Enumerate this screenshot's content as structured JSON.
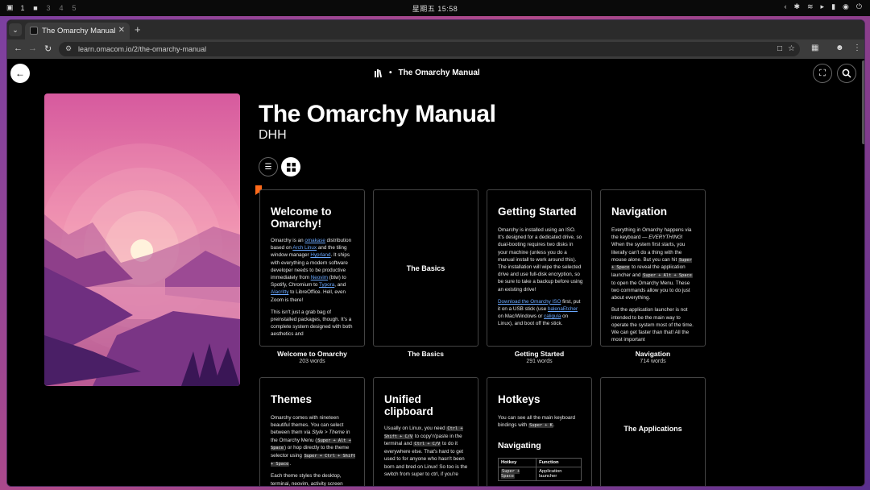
{
  "os": {
    "workspaces": [
      "1",
      "2",
      "3",
      "4",
      "5"
    ],
    "clock": "星期五 15:58"
  },
  "browser": {
    "tab_title": "The Omarchy Manual",
    "url": "learn.omacom.io/2/the-omarchy-manual"
  },
  "page": {
    "header_title": "The Omarchy Manual",
    "book_title": "The Omarchy Manual",
    "author": "DHH"
  },
  "cards": {
    "welcome": {
      "title": "Welcome to Omarchy!",
      "p1": [
        {
          "t": "Omarchy is an "
        },
        {
          "t": "omakase",
          "link": true
        },
        {
          "t": " distribution based on "
        },
        {
          "t": "Arch Linux",
          "link": true
        },
        {
          "t": " and the tiling window manager "
        },
        {
          "t": "Hyprland",
          "link": true
        },
        {
          "t": ". It ships with everything a modern software developer needs to be productive immediately from "
        },
        {
          "t": "Neovim",
          "link": true
        },
        {
          "t": " (btw) to Spotify, Chromium to "
        },
        {
          "t": "Typora",
          "link": true
        },
        {
          "t": ", and "
        },
        {
          "t": "Alacritty",
          "link": true
        },
        {
          "t": " to LibreOffice. Hell, even Zoom is there!"
        }
      ],
      "p2": "This isn't just a grab bag of preinstalled packages, though. It's a complete system designed with both aesthetics and",
      "caption": "Welcome to Omarchy",
      "words": "203 words"
    },
    "basics": {
      "title": "The Basics",
      "caption": "The Basics"
    },
    "getting_started": {
      "title": "Getting Started",
      "p1": "Omarchy is installed using an ISO. It's designed for a dedicated drive, so dual-booting requires two disks in your machine (unless you do a manual install to work around this). The installation will wipe the selected drive and use full-disk encryption, so be sure to take a backup before using an existing drive!",
      "p2": [
        {
          "t": "Download the Omarchy ISO",
          "link": true
        },
        {
          "t": " first, put it on a USB stick (use "
        },
        {
          "t": "balenaEtcher",
          "link": true
        },
        {
          "t": " on Mac/Windows or "
        },
        {
          "t": "caligula",
          "link": true
        },
        {
          "t": " on Linux), and boot off the stick."
        }
      ],
      "caption": "Getting Started",
      "words": "291 words"
    },
    "navigation": {
      "title": "Navigation",
      "p1": [
        {
          "t": "Everything in Omarchy happens via the keyboard — "
        },
        {
          "t": "EVERYTHING",
          "em": true
        },
        {
          "t": "! When the system first starts, you literally can't do a thing with the mouse alone. But you can hit "
        },
        {
          "t": "Super + Space",
          "kbd": true
        },
        {
          "t": " to reveal the application launcher and "
        },
        {
          "t": "Super + Alt + Space",
          "kbd": true
        },
        {
          "t": " to open the Omarchy Menu. These two commands allow you to do just about everything."
        }
      ],
      "p2": "But the application launcher is not intended to be the main way to operate the system most of the time. We can get faster than that! All the most important",
      "caption": "Navigation",
      "words": "714 words"
    },
    "themes": {
      "title": "Themes",
      "p1": [
        {
          "t": "Omarchy comes with nineteen beautiful themes. You can select between them via "
        },
        {
          "t": "Style > Theme",
          "em": true
        },
        {
          "t": " in the Omarchy Menu ("
        },
        {
          "t": "Super + Alt + Space",
          "kbd": true
        },
        {
          "t": ") or hop directly to the theme selector using "
        },
        {
          "t": "Super + Ctrl + Shift + Space",
          "kbd": true
        },
        {
          "t": "."
        }
      ],
      "p2": "Each theme styles the desktop, terminal, neovim, activity screen"
    },
    "clipboard": {
      "title": "Unified clipboard",
      "p1": [
        {
          "t": "Usually on Linux, you need "
        },
        {
          "t": "Ctrl + Shift + C/V",
          "kbd": true
        },
        {
          "t": " to copy'n'paste in the terminal and "
        },
        {
          "t": "Ctrl + C/V",
          "kbd": true
        },
        {
          "t": " to do it everywhere else. That's hard to get used to for anyone who hasn't been born and bred on Linux! So too is the switch from super to ctrl, if you're"
        }
      ]
    },
    "hotkeys": {
      "title": "Hotkeys",
      "p1": [
        {
          "t": "You can see all the main keyboard bindings with "
        },
        {
          "t": "Super + K",
          "kbd": true
        },
        {
          "t": "."
        }
      ],
      "subtitle": "Navigating",
      "table_headers": [
        "Hotkey",
        "Function"
      ],
      "table_rows": [
        {
          "key": "Super + Space",
          "fn": "Application launcher"
        }
      ]
    },
    "applications": {
      "title": "The Applications"
    }
  }
}
